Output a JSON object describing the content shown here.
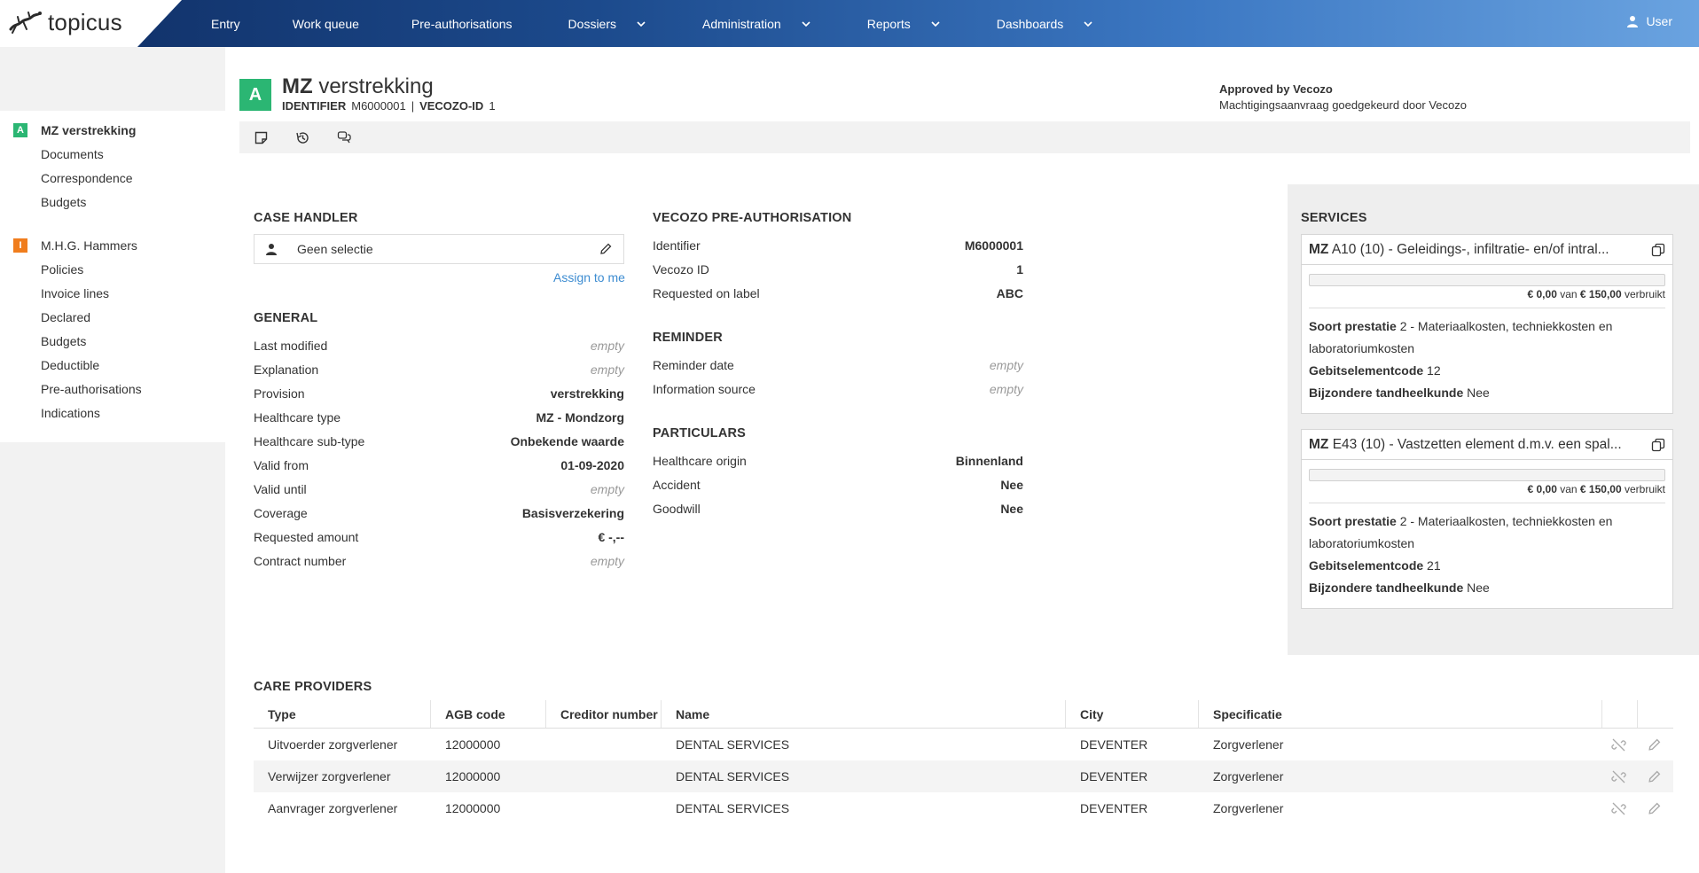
{
  "brand": {
    "name": "topicus"
  },
  "nav": {
    "items": [
      {
        "label": "Entry"
      },
      {
        "label": "Work queue"
      },
      {
        "label": "Pre-authorisations"
      },
      {
        "label": "Dossiers"
      },
      {
        "label": "Administration"
      },
      {
        "label": "Reports"
      },
      {
        "label": "Dashboards"
      }
    ],
    "user": "User"
  },
  "sidebar": {
    "group1": {
      "badge": "A",
      "badge_color": "#2bb673",
      "items": [
        "MZ verstrekking",
        "Documents",
        "Correspondence",
        "Budgets"
      ]
    },
    "group2": {
      "badge": "I",
      "badge_color": "#f07d1d",
      "items": [
        "M.H.G. Hammers",
        "Policies",
        "Invoice lines",
        "Declared",
        "Budgets",
        "Deductible",
        "Pre-authorisations",
        "Indications"
      ]
    }
  },
  "header": {
    "badge": "A",
    "title_bold": "MZ",
    "title_rest": "verstrekking",
    "identifier_label": "IDENTIFIER",
    "identifier_value": "M6000001",
    "separator": "|",
    "vecozo_label": "VECOZO-ID",
    "vecozo_value": "1",
    "status_title": "Approved by Vecozo",
    "status_text": "Machtigingsaanvraag goedgekeurd door Vecozo"
  },
  "case_handler": {
    "title": "CASE HANDLER",
    "value": "Geen selectie",
    "assign": "Assign to me"
  },
  "general": {
    "title": "GENERAL",
    "rows": [
      {
        "label": "Last modified",
        "value": "empty"
      },
      {
        "label": "Explanation",
        "value": "empty"
      },
      {
        "label": "Provision",
        "value": "verstrekking"
      },
      {
        "label": "Healthcare type",
        "value": "MZ - Mondzorg"
      },
      {
        "label": "Healthcare sub-type",
        "value": "Onbekende waarde"
      },
      {
        "label": "Valid from",
        "value": "01-09-2020"
      },
      {
        "label": "Valid until",
        "value": "empty"
      },
      {
        "label": "Coverage",
        "value": "Basisverzekering"
      },
      {
        "label": "Requested amount",
        "value": "€ -,--"
      },
      {
        "label": "Contract number",
        "value": "empty"
      }
    ]
  },
  "vecozo": {
    "title": "VECOZO PRE-AUTHORISATION",
    "rows": [
      {
        "label": "Identifier",
        "value": "M6000001"
      },
      {
        "label": "Vecozo ID",
        "value": "1"
      },
      {
        "label": "Requested on label",
        "value": "ABC"
      }
    ]
  },
  "reminder": {
    "title": "REMINDER",
    "rows": [
      {
        "label": "Reminder date",
        "value": "empty"
      },
      {
        "label": "Information source",
        "value": "empty"
      }
    ]
  },
  "particulars": {
    "title": "PARTICULARS",
    "rows": [
      {
        "label": "Healthcare origin",
        "value": "Binnenland"
      },
      {
        "label": "Accident",
        "value": "Nee"
      },
      {
        "label": "Goodwill",
        "value": "Nee"
      }
    ]
  },
  "services": {
    "title": "SERVICES",
    "cards": [
      {
        "code_bold": "MZ",
        "code_rest": "A10 (10) - Geleidings-, infiltratie- en/of intral...",
        "used_fraction": 0,
        "used_amount": "€ 0,00",
        "used_of": "van",
        "used_total": "€ 150,00",
        "used_suffix": "verbruikt",
        "soort_label": "Soort prestatie",
        "soort_value": "2 - Materiaalkosten, techniekkosten en laboratoriumkosten",
        "gebit_label": "Gebitselementcode",
        "gebit_value": "12",
        "bijz_label": "Bijzondere tandheelkunde",
        "bijz_value": "Nee"
      },
      {
        "code_bold": "MZ",
        "code_rest": "E43 (10) - Vastzetten element d.m.v. een spal...",
        "used_fraction": 0,
        "used_amount": "€ 0,00",
        "used_of": "van",
        "used_total": "€ 150,00",
        "used_suffix": "verbruikt",
        "soort_label": "Soort prestatie",
        "soort_value": "2 - Materiaalkosten, techniekkosten en laboratoriumkosten",
        "gebit_label": "Gebitselementcode",
        "gebit_value": "21",
        "bijz_label": "Bijzondere tandheelkunde",
        "bijz_value": "Nee"
      }
    ]
  },
  "care_providers": {
    "title": "CARE PROVIDERS",
    "columns": [
      "Type",
      "AGB code",
      "Creditor number",
      "Name",
      "City",
      "Specificatie"
    ],
    "rows": [
      {
        "type": "Uitvoerder zorgverlener",
        "agb": "12000000",
        "creditor": "",
        "name": "DENTAL SERVICES",
        "city": "DEVENTER",
        "spec": "Zorgverlener"
      },
      {
        "type": "Verwijzer zorgverlener",
        "agb": "12000000",
        "creditor": "",
        "name": "DENTAL SERVICES",
        "city": "DEVENTER",
        "spec": "Zorgverlener"
      },
      {
        "type": "Aanvrager zorgverlener",
        "agb": "12000000",
        "creditor": "",
        "name": "DENTAL SERVICES",
        "city": "DEVENTER",
        "spec": "Zorgverlener"
      }
    ]
  },
  "colors": {
    "accent": "#3d8cd1",
    "green": "#2bb673",
    "orange": "#f07d1d",
    "nav_dark": "#0f2d63"
  }
}
